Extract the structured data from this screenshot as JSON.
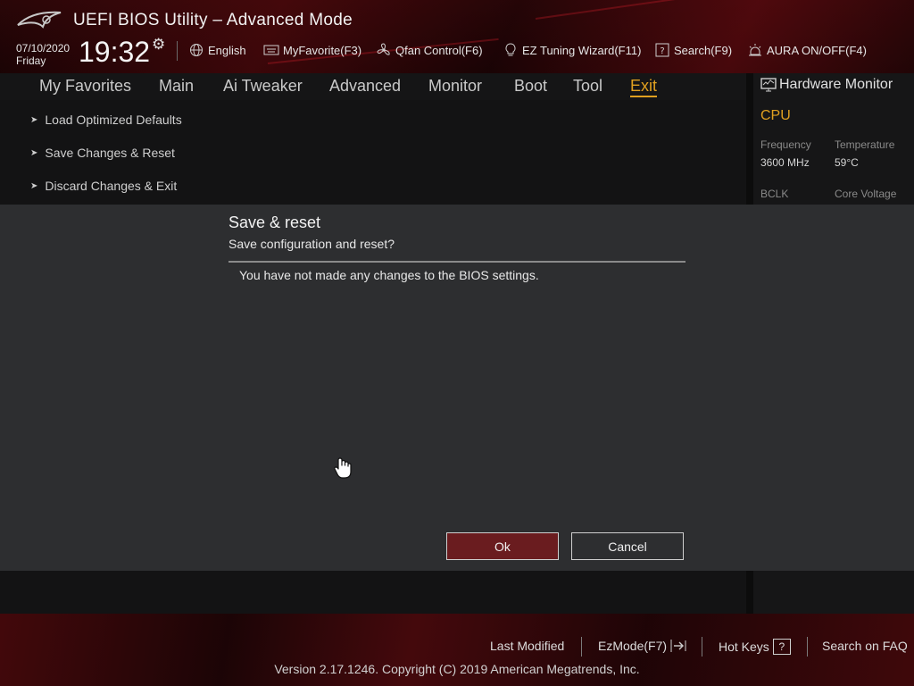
{
  "header": {
    "title": "UEFI BIOS Utility – Advanced Mode",
    "date": "07/10/2020",
    "day": "Friday",
    "time": "19:32",
    "buttons": [
      {
        "label": "English",
        "icon": "globe-icon"
      },
      {
        "label": "MyFavorite(F3)",
        "icon": "keyboard-icon"
      },
      {
        "label": "Qfan Control(F6)",
        "icon": "fan-icon"
      },
      {
        "label": "EZ Tuning Wizard(F11)",
        "icon": "lightbulb-icon"
      },
      {
        "label": "Search(F9)",
        "icon": "help-box-icon"
      },
      {
        "label": "AURA ON/OFF(F4)",
        "icon": "aura-light-icon"
      }
    ]
  },
  "tabs": [
    {
      "label": "My Favorites"
    },
    {
      "label": "Main"
    },
    {
      "label": "Ai Tweaker"
    },
    {
      "label": "Advanced"
    },
    {
      "label": "Monitor"
    },
    {
      "label": "Boot"
    },
    {
      "label": "Tool"
    },
    {
      "label": "Exit",
      "active": true
    }
  ],
  "exit_menu": {
    "items": [
      {
        "label": "Load Optimized Defaults"
      },
      {
        "label": "Save Changes & Reset"
      },
      {
        "label": "Discard Changes & Exit"
      }
    ]
  },
  "hardware_monitor": {
    "title": "Hardware Monitor",
    "section": "CPU",
    "frequency_label": "Frequency",
    "frequency_value": "3600 MHz",
    "temperature_label": "Temperature",
    "temperature_value": "59°C",
    "bclk_label": "BCLK",
    "core_voltage_label": "Core Voltage"
  },
  "dialog": {
    "title": "Save & reset",
    "subtitle": "Save configuration and reset?",
    "message": "You have not made any changes to the BIOS settings.",
    "ok_label": "Ok",
    "cancel_label": "Cancel"
  },
  "footer": {
    "last_modified": "Last Modified",
    "ezmode": "EzMode(F7)",
    "hot_keys": "Hot Keys",
    "hot_keys_key": "?",
    "search_faq": "Search on FAQ",
    "copyright": "Version 2.17.1246. Copyright (C) 2019 American Megatrends, Inc."
  },
  "colors": {
    "accent": "#e0a020",
    "ok_button": "#6a1c1f",
    "dialog_bg": "#2d2e30"
  }
}
